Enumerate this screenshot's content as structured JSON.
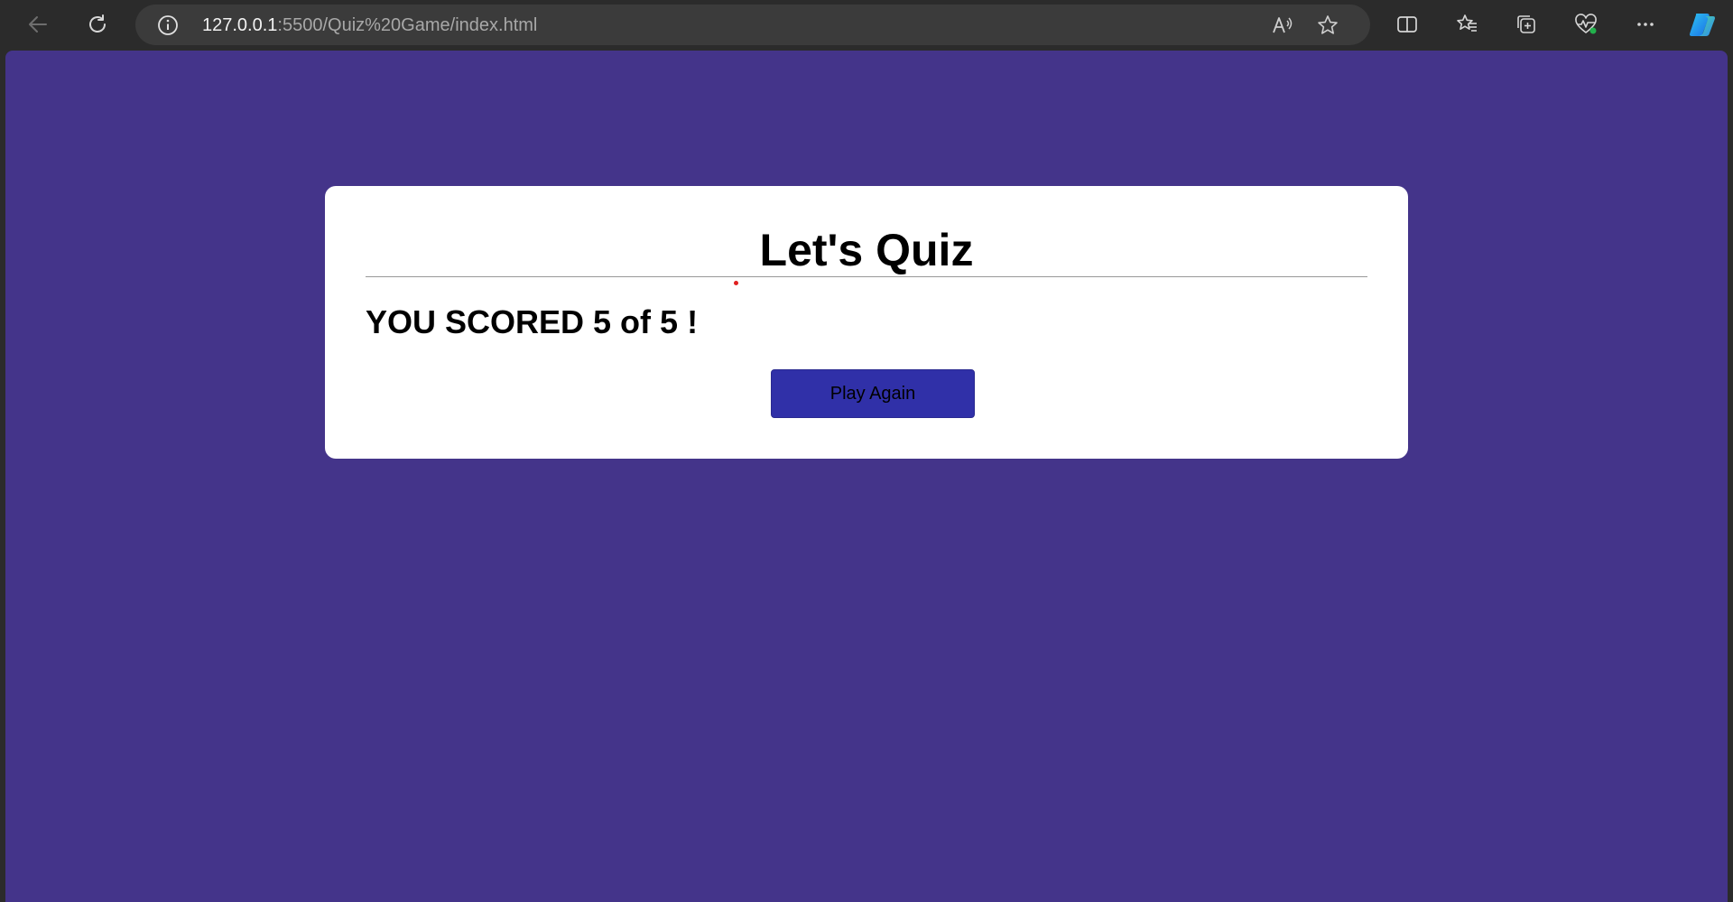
{
  "browser": {
    "url_host": "127.0.0.1",
    "url_rest": ":5500/Quiz%20Game/index.html",
    "icons": {
      "back": "back-arrow-icon",
      "reload": "reload-icon",
      "site_info": "info-icon",
      "read_aloud": "read-aloud-icon",
      "favorite": "star-icon",
      "split_screen": "split-screen-icon",
      "favorites": "favorites-icon",
      "collections": "collections-icon",
      "performance": "heartbeat-icon",
      "more": "more-icon",
      "copilot": "copilot-icon"
    }
  },
  "page": {
    "background_color": "#44348a"
  },
  "quiz": {
    "title": "Let's Quiz",
    "score_text": "YOU SCORED 5 of 5 !",
    "play_again_label": "Play Again",
    "button_color": "#3030a8"
  }
}
